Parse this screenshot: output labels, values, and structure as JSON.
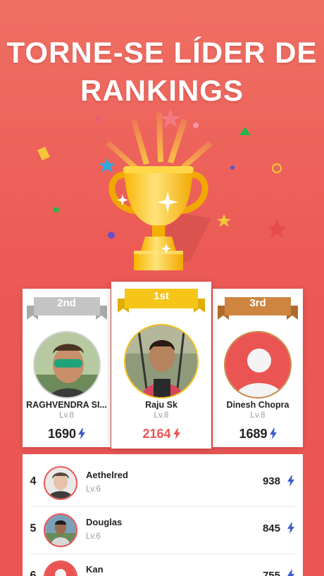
{
  "headline": {
    "line1": "TORNE-SE LÍDER DE",
    "line2": "RANKINGS"
  },
  "colors": {
    "background": "#ea5452",
    "gold": "#f5c518",
    "silver": "#c4c4c4",
    "bronze": "#cd8540",
    "bolt": "#3a5ccc"
  },
  "podium": [
    {
      "place": "2nd",
      "name": "RAGHVENDRA SI...",
      "level": "Lv.8",
      "score": "1690"
    },
    {
      "place": "1st",
      "name": "Raju Sk",
      "level": "Lv.8",
      "score": "2164"
    },
    {
      "place": "3rd",
      "name": "Dinesh Chopra",
      "level": "Lv.8",
      "score": "1689"
    }
  ],
  "list": [
    {
      "rank": "4",
      "name": "Aethelred",
      "level": "Lv.6",
      "score": "938"
    },
    {
      "rank": "5",
      "name": "Douglas",
      "level": "Lv.6",
      "score": "845"
    },
    {
      "rank": "6",
      "name": "Kan",
      "level": "",
      "score": "755"
    }
  ]
}
